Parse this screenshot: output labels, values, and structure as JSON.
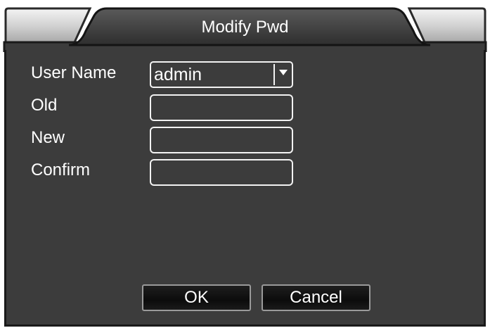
{
  "dialog": {
    "title": "Modify Pwd"
  },
  "form": {
    "user_name_label": "User Name",
    "user_name_value": "admin",
    "old_label": "Old",
    "new_label": "New",
    "confirm_label": "Confirm",
    "old_value": "",
    "new_value": "",
    "confirm_value": ""
  },
  "buttons": {
    "ok_label": "OK",
    "cancel_label": "Cancel"
  },
  "icons": {
    "dropdown": "chevron-down-icon"
  },
  "colors": {
    "panel_background": "#3c3c3c",
    "text": "#ffffff"
  }
}
